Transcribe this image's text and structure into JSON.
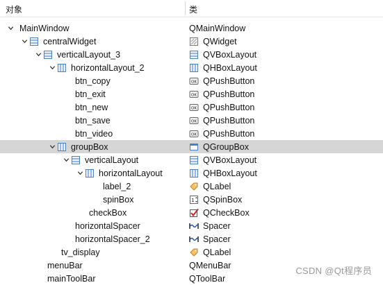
{
  "header": {
    "object_label": "对象",
    "class_label": "类"
  },
  "rows": [
    {
      "name": "MainWindow",
      "cls": "QMainWindow",
      "depth": 0,
      "arrow": true,
      "obj_icon": "",
      "cls_icon": ""
    },
    {
      "name": "centralWidget",
      "cls": "QWidget",
      "depth": 1,
      "arrow": true,
      "obj_icon": "vlayout",
      "cls_icon": "widget"
    },
    {
      "name": "verticalLayout_3",
      "cls": "QVBoxLayout",
      "depth": 2,
      "arrow": true,
      "obj_icon": "vlayout",
      "cls_icon": "vlayout"
    },
    {
      "name": "horizontalLayout_2",
      "cls": "QHBoxLayout",
      "depth": 3,
      "arrow": true,
      "obj_icon": "hlayout",
      "cls_icon": "hlayout"
    },
    {
      "name": "btn_copy",
      "cls": "QPushButton",
      "depth": 4,
      "arrow": false,
      "obj_icon": "",
      "cls_icon": "pushbutton"
    },
    {
      "name": "btn_exit",
      "cls": "QPushButton",
      "depth": 4,
      "arrow": false,
      "obj_icon": "",
      "cls_icon": "pushbutton"
    },
    {
      "name": "btn_new",
      "cls": "QPushButton",
      "depth": 4,
      "arrow": false,
      "obj_icon": "",
      "cls_icon": "pushbutton"
    },
    {
      "name": "btn_save",
      "cls": "QPushButton",
      "depth": 4,
      "arrow": false,
      "obj_icon": "",
      "cls_icon": "pushbutton"
    },
    {
      "name": "btn_video",
      "cls": "QPushButton",
      "depth": 4,
      "arrow": false,
      "obj_icon": "",
      "cls_icon": "pushbutton"
    },
    {
      "name": "groupBox",
      "cls": "QGroupBox",
      "depth": 3,
      "arrow": true,
      "obj_icon": "hlayout",
      "cls_icon": "groupbox",
      "selected": true
    },
    {
      "name": "verticalLayout",
      "cls": "QVBoxLayout",
      "depth": 4,
      "arrow": true,
      "obj_icon": "vlayout",
      "cls_icon": "vlayout"
    },
    {
      "name": "horizontalLayout",
      "cls": "QHBoxLayout",
      "depth": 5,
      "arrow": true,
      "obj_icon": "hlayout",
      "cls_icon": "hlayout"
    },
    {
      "name": "label_2",
      "cls": "QLabel",
      "depth": 6,
      "arrow": false,
      "obj_icon": "",
      "cls_icon": "label"
    },
    {
      "name": "spinBox",
      "cls": "QSpinBox",
      "depth": 6,
      "arrow": false,
      "obj_icon": "",
      "cls_icon": "spinbox"
    },
    {
      "name": "checkBox",
      "cls": "QCheckBox",
      "depth": 5,
      "arrow": false,
      "obj_icon": "",
      "cls_icon": "checkbox"
    },
    {
      "name": "horizontalSpacer",
      "cls": "Spacer",
      "depth": 4,
      "arrow": false,
      "obj_icon": "",
      "cls_icon": "spacer"
    },
    {
      "name": "horizontalSpacer_2",
      "cls": "Spacer",
      "depth": 4,
      "arrow": false,
      "obj_icon": "",
      "cls_icon": "spacer"
    },
    {
      "name": "tv_display",
      "cls": "QLabel",
      "depth": 3,
      "arrow": false,
      "obj_icon": "",
      "cls_icon": "label"
    },
    {
      "name": "menuBar",
      "cls": "QMenuBar",
      "depth": 2,
      "arrow": false,
      "obj_icon": "",
      "cls_icon": ""
    },
    {
      "name": "mainToolBar",
      "cls": "QToolBar",
      "depth": 2,
      "arrow": false,
      "obj_icon": "",
      "cls_icon": ""
    }
  ],
  "watermark": "CSDN @Qt程序员",
  "colors": {
    "selected_row": "#d6d6d6",
    "layout_icon": "#4a7fc1"
  }
}
